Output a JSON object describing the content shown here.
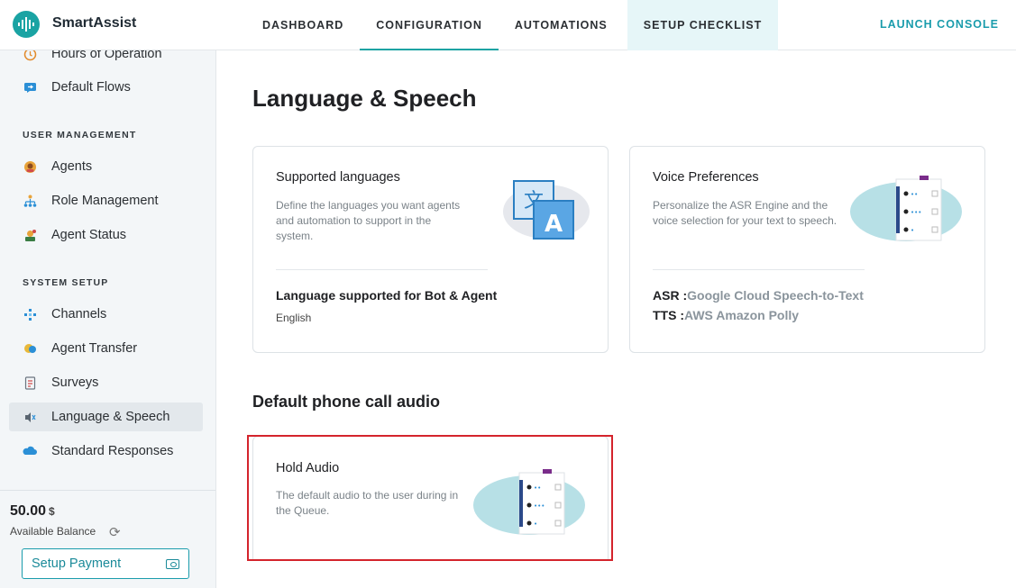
{
  "app": {
    "name": "SmartAssist"
  },
  "nav": {
    "tabs": [
      {
        "label": "DASHBOARD"
      },
      {
        "label": "CONFIGURATION"
      },
      {
        "label": "AUTOMATIONS"
      },
      {
        "label": "SETUP CHECKLIST"
      }
    ],
    "active": "CONFIGURATION",
    "launch": "LAUNCH CONSOLE"
  },
  "sidebar": {
    "items_top": [
      {
        "label": "Hours of Operation",
        "icon": "clock-icon"
      },
      {
        "label": "Default Flows",
        "icon": "flow-icon"
      }
    ],
    "user_management": {
      "title": "USER MANAGEMENT",
      "items": [
        {
          "label": "Agents",
          "icon": "agent-icon"
        },
        {
          "label": "Role Management",
          "icon": "hierarchy-icon"
        },
        {
          "label": "Agent Status",
          "icon": "status-icon"
        }
      ]
    },
    "system_setup": {
      "title": "SYSTEM SETUP",
      "items": [
        {
          "label": "Channels",
          "icon": "channels-icon"
        },
        {
          "label": "Agent Transfer",
          "icon": "transfer-icon"
        },
        {
          "label": "Surveys",
          "icon": "survey-icon"
        },
        {
          "label": "Language & Speech",
          "icon": "speech-icon",
          "active": true
        },
        {
          "label": "Standard Responses",
          "icon": "cloud-icon"
        }
      ]
    },
    "balance": {
      "amount": "50.00",
      "currency": "$",
      "label": "Available Balance",
      "button": "Setup Payment"
    }
  },
  "main": {
    "title": "Language & Speech",
    "languages_card": {
      "title": "Supported languages",
      "description": "Define the languages you want agents and automation to support in the system.",
      "sub_title": "Language supported for Bot & Agent",
      "value": "English"
    },
    "voice_card": {
      "title": "Voice Preferences",
      "description": "Personalize the ASR Engine and the voice selection for your text to speech.",
      "asr_label": "ASR :",
      "asr_value": "Google Cloud Speech-to-Text",
      "tts_label": "TTS :",
      "tts_value": "AWS Amazon Polly"
    },
    "audio_section": {
      "title": "Default phone call audio",
      "hold_card": {
        "title": "Hold Audio",
        "description": "The default audio to the user during in the Queue."
      }
    }
  },
  "colors": {
    "accent": "#1aa3a3",
    "highlight_border": "#d4242c",
    "active_tab_bg": "#e6f6f8"
  }
}
